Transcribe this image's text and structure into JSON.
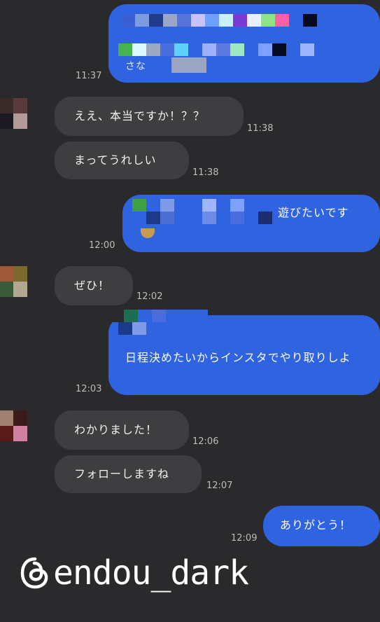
{
  "messages": [
    {
      "id": "m1",
      "side": "sent",
      "text": "さな",
      "time": "11:37",
      "censored": true
    },
    {
      "id": "m2",
      "side": "recv",
      "text": "ええ、本当ですか！？？",
      "time": "11:38"
    },
    {
      "id": "m3",
      "side": "recv",
      "text": "まってうれしい",
      "time": "11:38"
    },
    {
      "id": "m4",
      "side": "sent",
      "text": "遊びたいです",
      "time": "12:00",
      "censored": true
    },
    {
      "id": "m5",
      "side": "recv",
      "text": "ぜひ！",
      "time": "12:02"
    },
    {
      "id": "m6",
      "side": "sent",
      "text": "日程決めたいからインスタでやり取りしよ",
      "time": "12:03"
    },
    {
      "id": "m7",
      "side": "recv",
      "text": "わかりました！",
      "time": "12:06"
    },
    {
      "id": "m8",
      "side": "recv",
      "text": "フォローしますね",
      "time": "12:07"
    },
    {
      "id": "m9",
      "side": "sent",
      "text": "ありがとう！",
      "time": "12:09"
    }
  ],
  "watermark": {
    "handle": "@endou_dark"
  },
  "colors": {
    "background": "#2a2a2c",
    "sent_bubble": "#2f63e0",
    "recv_bubble": "#3e3e41",
    "timestamp": "#bdbdbd"
  },
  "icons": {
    "watermark_logo": "threads-icon"
  }
}
